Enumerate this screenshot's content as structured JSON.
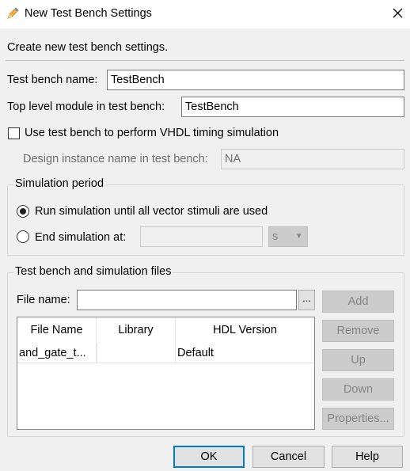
{
  "window": {
    "title": "New Test Bench Settings",
    "close_glyph": "✕",
    "icon": "pencil-icon"
  },
  "caption": "Create new test bench settings.",
  "fields": {
    "tb_name_label": "Test bench name:",
    "tb_name_value": "TestBench",
    "top_module_label": "Top level module in test bench:",
    "top_module_value": "TestBench",
    "vhdl_timing_label": "Use test bench to perform VHDL timing simulation",
    "vhdl_timing_checked": false,
    "design_instance_label": "Design instance name in test bench:",
    "design_instance_value": "NA"
  },
  "simulation_period": {
    "title": "Simulation period",
    "run_all_label": "Run simulation until all vector stimuli are used",
    "run_all_selected": true,
    "end_at_label": "End simulation at:",
    "end_at_value": "",
    "unit_value": "s",
    "unit_arrow": "▾"
  },
  "files": {
    "title": "Test bench and simulation files",
    "file_name_label": "File name:",
    "file_name_value": "",
    "browse_label": "...",
    "columns": [
      "File Name",
      "Library",
      "HDL Version"
    ],
    "rows": [
      {
        "file_name": "and_gate_t...",
        "library": "",
        "hdl_version": "Default"
      }
    ],
    "buttons": {
      "add": "Add",
      "remove": "Remove",
      "up": "Up",
      "down": "Down",
      "properties": "Properties..."
    }
  },
  "footer": {
    "ok": "OK",
    "cancel": "Cancel",
    "help": "Help"
  },
  "colors": {
    "focus_border": "#0078d7",
    "disabled_button": "#cccccc",
    "window_bg": "#f0f0f0"
  }
}
